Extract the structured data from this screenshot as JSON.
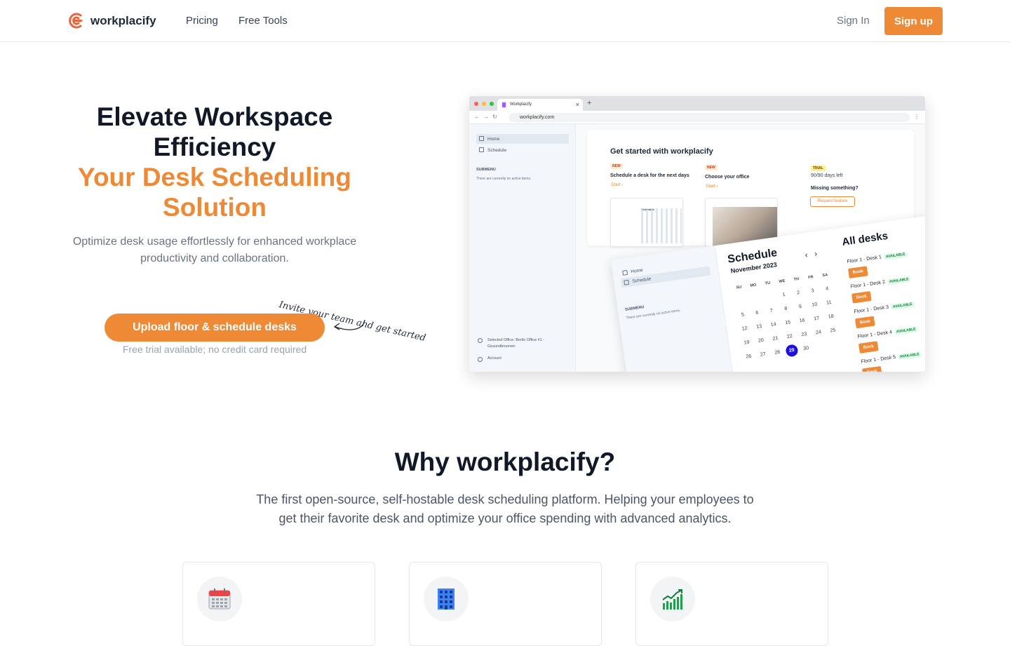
{
  "nav": {
    "brand": "workplacify",
    "links": [
      "Pricing",
      "Free Tools"
    ],
    "sign_in": "Sign In",
    "sign_up": "Sign up"
  },
  "hero": {
    "title_line1": "Elevate Workspace Efficiency",
    "title_line2": "Your Desk Scheduling Solution",
    "subtitle": "Optimize desk usage effortlessly for enhanced workplace productivity and collaboration.",
    "cta": "Upload floor & schedule desks",
    "cta_note": "Free trial available; no credit card required",
    "handwritten_note": "Invite your team and get started"
  },
  "mock": {
    "tab_title": "Workplacify",
    "url": "workplacify.com",
    "sidebar": {
      "items": [
        "Home",
        "Schedule"
      ],
      "submenu_heading": "SUBMENU",
      "submenu_text": "There are currently no active items.",
      "selected_office": "Selected Office: Berlin Office #1 - Gesundbrunnen",
      "account": "Account"
    },
    "get_started": {
      "title": "Get started with workplacify",
      "card1_badge": "NEW",
      "card1_title": "Schedule a desk for the next days",
      "card1_link": "Start ›",
      "card2_badge": "NEW",
      "card2_title": "Choose your office",
      "card2_link": "Start ›",
      "trial_badge": "TRIAL",
      "trial_text": "90/90 days left",
      "missing_title": "Missing something?",
      "request_button": "Request feature",
      "thumb_label": "Schedule"
    },
    "schedule": {
      "title": "Schedule",
      "month": "November 2023",
      "weekdays": [
        "SU",
        "MO",
        "TU",
        "WE",
        "TH",
        "FR",
        "SA"
      ],
      "weeks": [
        [
          "",
          "",
          "",
          "1",
          "2",
          "3",
          "4"
        ],
        [
          "5",
          "6",
          "7",
          "8",
          "9",
          "10",
          "11"
        ],
        [
          "12",
          "13",
          "14",
          "15",
          "16",
          "17",
          "18"
        ],
        [
          "19",
          "20",
          "21",
          "22",
          "23",
          "24",
          "25"
        ],
        [
          "26",
          "27",
          "28",
          "29",
          "30",
          "",
          ""
        ]
      ],
      "selected_day": "29",
      "desks_title": "All desks",
      "desks": [
        {
          "name": "Floor 1 - Desk 1",
          "status": "AVAILABLE",
          "action": "Book"
        },
        {
          "name": "Floor 1 - Desk 2",
          "status": "AVAILABLE",
          "action": "Book"
        },
        {
          "name": "Floor 1 - Desk 3",
          "status": "AVAILABLE",
          "action": "Book"
        },
        {
          "name": "Floor 1 - Desk 4",
          "status": "AVAILABLE",
          "action": "Book"
        },
        {
          "name": "Floor 1 - Desk 5",
          "status": "AVAILABLE",
          "action": "Book"
        }
      ]
    }
  },
  "why": {
    "title": "Why workplacify?",
    "subtitle": "The first open-source, self-hostable desk scheduling platform. Helping your employees to get their favorite desk and optimize your office spending with advanced analytics.",
    "features": [
      {
        "icon": "calendar-icon"
      },
      {
        "icon": "office-building-icon"
      },
      {
        "icon": "chart-increasing-icon"
      }
    ]
  },
  "colors": {
    "accent": "#ee8a36",
    "heading": "#111827",
    "muted": "#6b7280",
    "selected_day": "#1d0fe0"
  }
}
